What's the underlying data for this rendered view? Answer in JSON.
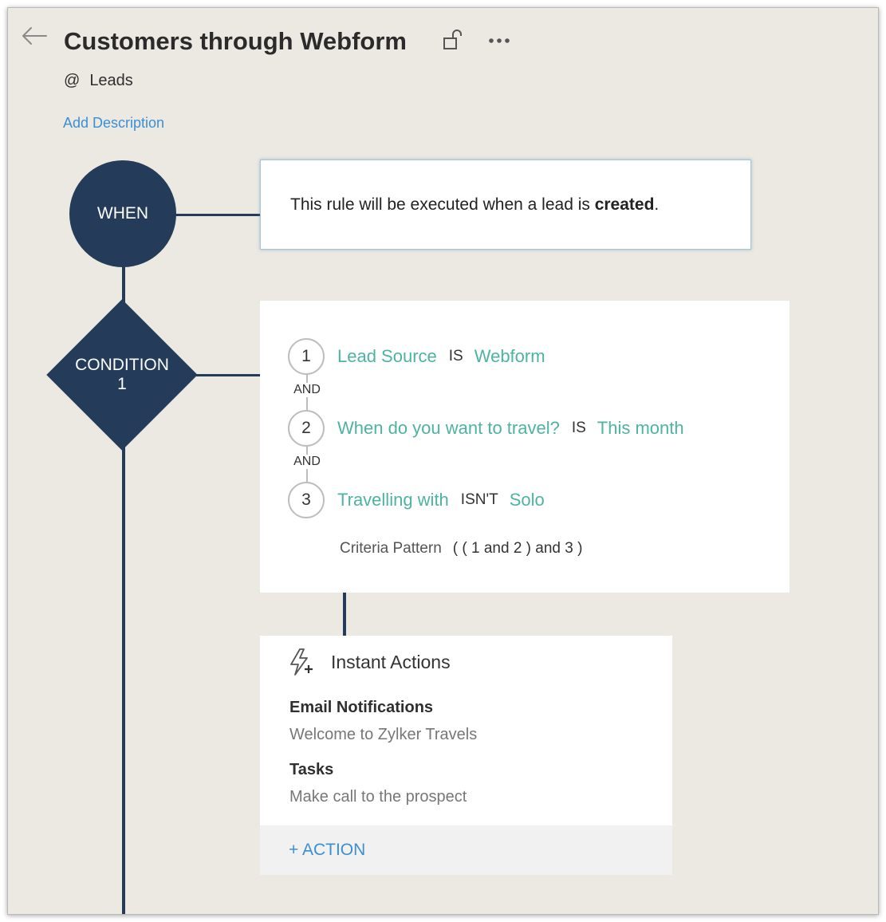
{
  "header": {
    "title": "Customers through Webform",
    "module_prefix": "@",
    "module": "Leads",
    "add_description": "Add Description"
  },
  "when": {
    "label": "WHEN",
    "text_before": "This rule will be executed when a lead is ",
    "text_bold": "created",
    "text_after": "."
  },
  "condition": {
    "label_line1": "CONDITION",
    "label_line2": "1",
    "criteria": [
      {
        "num": "1",
        "field": "Lead Source",
        "op": "IS",
        "value": "Webform"
      },
      {
        "num": "2",
        "field": "When do you want to travel?",
        "op": "IS",
        "value": "This month"
      },
      {
        "num": "3",
        "field": "Travelling with",
        "op": "ISN'T",
        "value": "Solo"
      }
    ],
    "joiners": [
      "AND",
      "AND"
    ],
    "pattern_label": "Criteria Pattern",
    "pattern_value": "( ( 1 and 2 ) and 3 )"
  },
  "actions": {
    "title": "Instant Actions",
    "items": [
      {
        "heading": "Email Notifications",
        "detail": "Welcome to Zylker Travels"
      },
      {
        "heading": "Tasks",
        "detail": "Make call to the prospect"
      }
    ],
    "add_label": "+ ACTION"
  },
  "colors": {
    "node": "#243c5a",
    "field_teal": "#4db3a2",
    "link_blue": "#3b8fd4",
    "canvas": "#ebe9e2"
  },
  "icons": [
    "back-arrow-icon",
    "unlock-icon",
    "more-options-icon",
    "instant-action-bolt-icon"
  ]
}
